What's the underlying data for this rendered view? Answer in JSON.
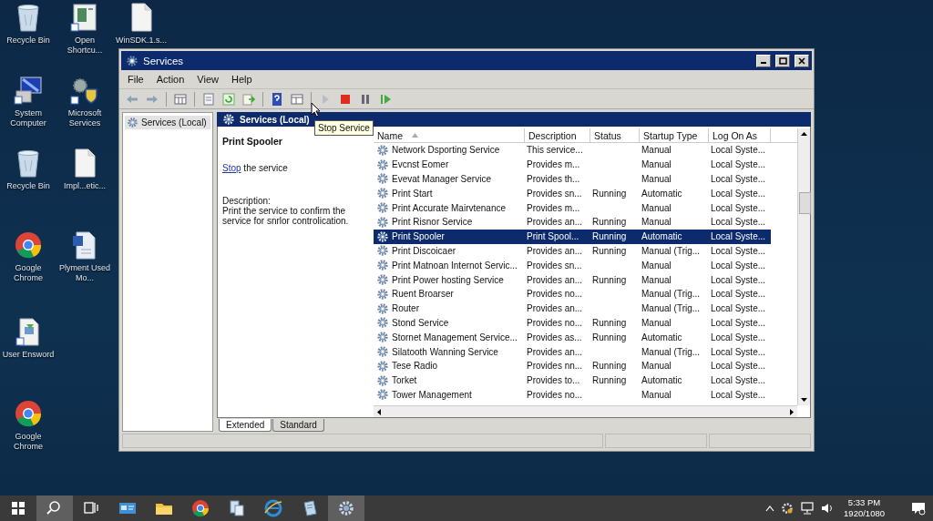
{
  "desktop_icons": [
    {
      "label": "Recycle Bin",
      "kind": "recycle"
    },
    {
      "label": "Open Shortcu...",
      "kind": "shortcut"
    },
    {
      "label": "WinSDK.1.s...",
      "kind": "file"
    },
    {
      "label": "System Computer",
      "kind": "computer"
    },
    {
      "label": "Microsoft Services",
      "kind": "services"
    },
    {
      "label": "Recycle Bin",
      "kind": "recycle"
    },
    {
      "label": "Impl...etic...",
      "kind": "file"
    },
    {
      "label": "Google Chrome",
      "kind": "chrome"
    },
    {
      "label": "Plyment Used Mo...",
      "kind": "word"
    },
    {
      "label": "User Ensword",
      "kind": "installer"
    },
    {
      "label": "Google Chrome",
      "kind": "chrome"
    }
  ],
  "window": {
    "title": "Services",
    "menu": [
      "File",
      "Action",
      "View",
      "Help"
    ],
    "toolbar": [
      {
        "kind": "back",
        "disabled": false
      },
      {
        "kind": "forward",
        "disabled": false
      },
      {
        "kind": "sep"
      },
      {
        "kind": "tree",
        "disabled": false
      },
      {
        "kind": "sep"
      },
      {
        "kind": "properties",
        "disabled": false
      },
      {
        "kind": "refresh",
        "disabled": false
      },
      {
        "kind": "export",
        "disabled": false
      },
      {
        "kind": "sep"
      },
      {
        "kind": "help",
        "disabled": false
      },
      {
        "kind": "view",
        "disabled": false
      },
      {
        "kind": "sep"
      },
      {
        "kind": "play",
        "disabled": true
      },
      {
        "kind": "stop",
        "disabled": false
      },
      {
        "kind": "pause",
        "disabled": false
      },
      {
        "kind": "resume",
        "disabled": false
      }
    ],
    "tree": [
      {
        "label": "Services (Local)",
        "selected": true
      }
    ],
    "pane_header": "Services (Local)",
    "tooltip": "Stop Service",
    "detail": {
      "title": "Print Spooler",
      "action_link": "Stop",
      "action_rest": "the service",
      "description_label": "Description:",
      "description": "Print the service to confirm the service for snrlor controlication."
    },
    "table": {
      "columns": [
        {
          "label": "Name",
          "sorted": true
        },
        {
          "label": "Description",
          "sorted": false
        },
        {
          "label": "Status",
          "sorted": false
        },
        {
          "label": "Startup Type",
          "sorted": false
        },
        {
          "label": "Log On As",
          "sorted": false
        }
      ],
      "rows": [
        {
          "name": "Network Dsporting Service",
          "description": "This service...",
          "startup_type": "Manual",
          "log_on_as": "Local Syste...",
          "selected": false
        },
        {
          "name": "Evcnst Eomer",
          "description": "Provides m...",
          "startup_type": "Manual",
          "log_on_as": "Local Syste...",
          "selected": false
        },
        {
          "name": "Evevat Manager Service",
          "description": "Provides th...",
          "startup_type": "Manual",
          "log_on_as": "Local Syste...",
          "selected": false
        },
        {
          "name": "Print Start",
          "description": "Provides sn...",
          "status": "Running",
          "startup_type": "Automatic",
          "log_on_as": "Local Syste...",
          "selected": false
        },
        {
          "name": "Print Accurate Mairvtenance",
          "description": "Provides m...",
          "startup_type": "Manual",
          "log_on_as": "Local Syste...",
          "selected": false
        },
        {
          "name": "Print Risnor Service",
          "description": "Provides an...",
          "status": "Running",
          "startup_type": "Manual",
          "log_on_as": "Local Syste...",
          "selected": false
        },
        {
          "name": "Print Spooler",
          "description": "Print Spool...",
          "status": "Running",
          "startup_type": "Automatic",
          "log_on_as": "Local Syste...",
          "selected": true
        },
        {
          "name": "Print Discoicaer",
          "description": "Provides an...",
          "status": "Running",
          "startup_type": "Manual (Trig...",
          "log_on_as": "Local Syste...",
          "selected": false
        },
        {
          "name": "Print Matnoan Internot Servic...",
          "description": "Provides sn...",
          "startup_type": "Manual",
          "log_on_as": "Local Syste...",
          "selected": false
        },
        {
          "name": "Print Power hosting Service",
          "description": "Provides an...",
          "status": "Running",
          "startup_type": "Manual",
          "log_on_as": "Local Syste...",
          "selected": false
        },
        {
          "name": "Ruent Broarser",
          "description": "Provides no...",
          "startup_type": "Manual (Trig...",
          "log_on_as": "Local Syste...",
          "selected": false
        },
        {
          "name": "Router",
          "description": "Provides an...",
          "startup_type": "Manual (Trig...",
          "log_on_as": "Local Syste...",
          "selected": false
        },
        {
          "name": "Stond Service",
          "description": "Provides no...",
          "status": "Running",
          "startup_type": "Manual",
          "log_on_as": "Local Syste...",
          "selected": false
        },
        {
          "name": "Stornet Management Service...",
          "description": "Provides as...",
          "status": "Running",
          "startup_type": "Automatic",
          "log_on_as": "Local Syste...",
          "selected": false
        },
        {
          "name": "Silatooth Wanning Service",
          "description": "Provides an...",
          "startup_type": "Manual (Trig...",
          "log_on_as": "Local Syste...",
          "selected": false
        },
        {
          "name": "Tese Radio",
          "description": "Provides nn...",
          "status": "Running",
          "startup_type": "Manual",
          "log_on_as": "Local Syste...",
          "selected": false
        },
        {
          "name": "Torket",
          "description": "Provides to...",
          "status": "Running",
          "startup_type": "Automatic",
          "log_on_as": "Local Syste...",
          "selected": false
        },
        {
          "name": "Tower Management",
          "description": "Provides no...",
          "startup_type": "Manual",
          "log_on_as": "Local Syste...",
          "selected": false
        }
      ]
    },
    "tabs": [
      {
        "label": "Extended",
        "selected": true
      },
      {
        "label": "Standard",
        "selected": false
      }
    ]
  },
  "taskbar": {
    "apps": [
      {
        "kind": "search",
        "active": true
      },
      {
        "kind": "taskview",
        "active": false
      },
      {
        "kind": "card",
        "active": false
      },
      {
        "kind": "folder",
        "active": false
      },
      {
        "kind": "chrome",
        "active": false
      },
      {
        "kind": "docs",
        "active": false
      },
      {
        "kind": "ie",
        "active": false
      },
      {
        "kind": "notepad",
        "active": false
      },
      {
        "kind": "services",
        "active": true
      }
    ],
    "time": "5:33 PM",
    "date": "1920/1080"
  }
}
